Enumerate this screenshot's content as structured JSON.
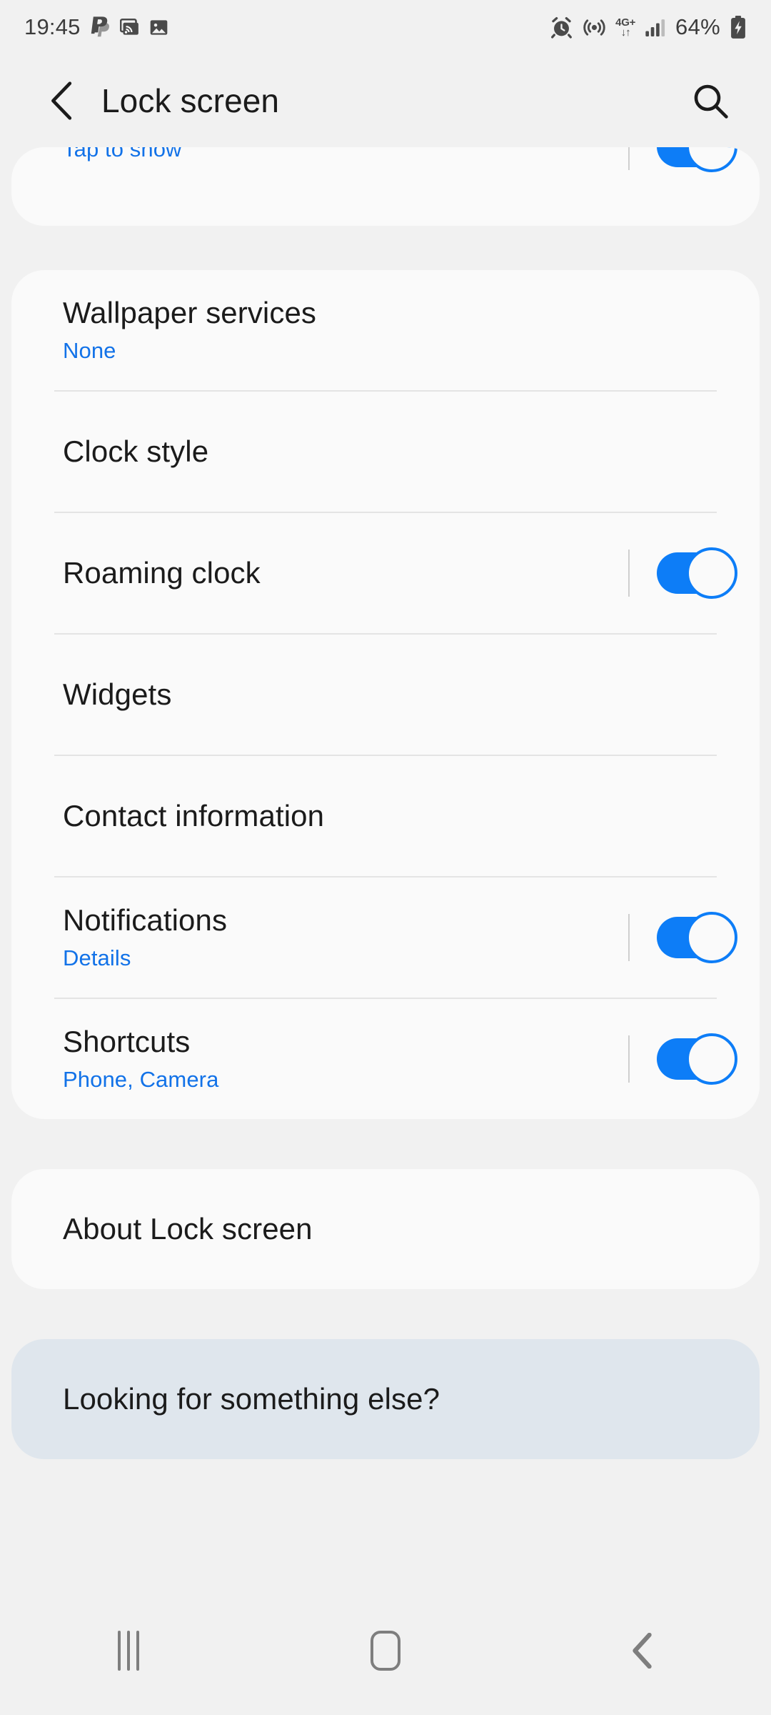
{
  "status_bar": {
    "time": "19:45",
    "left_icons": [
      "paypal-icon",
      "cast-icon",
      "image-icon"
    ],
    "network_label": "4G+",
    "network_arrows": "↓↑",
    "battery_percent": "64%",
    "right_icons": [
      "alarm-icon",
      "hotspot-icon",
      "network-4g-icon",
      "signal-icon",
      "battery-charging-icon"
    ]
  },
  "header": {
    "back_icon": "chevron-left-icon",
    "title": "Lock screen",
    "search_icon": "search-icon"
  },
  "colors": {
    "accent_blue": "#0D7DF7",
    "link_blue": "#1272E8",
    "page_background": "#F1F1F1",
    "card_background": "#FAFAFA",
    "highlight_card_background": "#DFE6ED",
    "divider": "#E4E4E4",
    "text_primary": "#1B1B1B"
  },
  "cards": [
    {
      "name": "partial-top-card",
      "clipped": true,
      "rows": [
        {
          "title": "",
          "subtitle": "Tap to show",
          "switch": true,
          "switch_on": true
        }
      ]
    },
    {
      "name": "main-settings-card",
      "rows": [
        {
          "title": "Wallpaper services",
          "subtitle": "None",
          "switch": false
        },
        {
          "title": "Clock style",
          "subtitle": "",
          "switch": false
        },
        {
          "title": "Roaming clock",
          "subtitle": "",
          "switch": true,
          "switch_on": true
        },
        {
          "title": "Widgets",
          "subtitle": "",
          "switch": false
        },
        {
          "title": "Contact information",
          "subtitle": "",
          "switch": false
        },
        {
          "title": "Notifications",
          "subtitle": "Details",
          "switch": true,
          "switch_on": true
        },
        {
          "title": "Shortcuts",
          "subtitle": "Phone, Camera",
          "switch": true,
          "switch_on": true
        }
      ]
    },
    {
      "name": "about-card",
      "rows": [
        {
          "title": "About Lock screen",
          "subtitle": "",
          "switch": false
        }
      ]
    },
    {
      "name": "looking-for-something-else-card",
      "highlight": true,
      "rows": [
        {
          "title": "Looking for something else?",
          "subtitle": "",
          "switch": false
        }
      ]
    }
  ],
  "nav_bar": {
    "recents_icon": "recents-icon",
    "home_icon": "home-icon",
    "back_icon": "back-chevron-icon"
  }
}
